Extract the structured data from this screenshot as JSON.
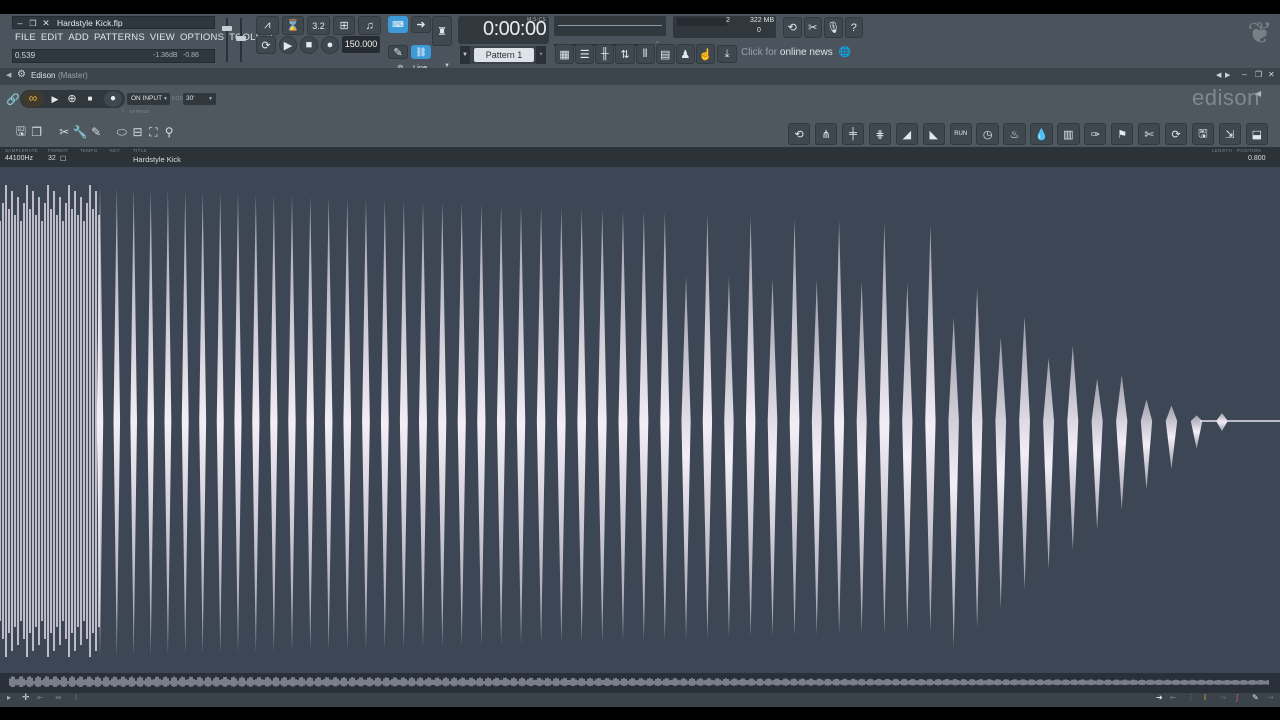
{
  "app": {
    "project_title": "Hardstyle Kick.flp",
    "menu": [
      "FILE",
      "EDIT",
      "ADD",
      "PATTERNS",
      "VIEW",
      "OPTIONS",
      "TOOLS",
      "?"
    ],
    "hint_value": "0.539",
    "hint_db": "-1.36dB",
    "hint_db2": "-0.86"
  },
  "transport": {
    "tempo": "150.000",
    "time": "0:00:00",
    "time_label": "M:S:CS",
    "pattern": "Pattern 1",
    "snap": "Line",
    "cpu_label": "2",
    "ram_label": "322 MB",
    "poly": "0",
    "news_prefix": "Click for ",
    "news_main": "online news"
  },
  "edison": {
    "title": "Edison",
    "subtitle": "(Master)",
    "logo": "edison",
    "input_label": "ON INPUT",
    "for_label": "FOR",
    "duration": "30'",
    "append_label": "APPEND"
  },
  "info": {
    "samplerate_label": "SAMPLERATE",
    "format_label": "FORMAT",
    "tempo_label": "TEMPO",
    "key_label": "KEY",
    "title_label": "TITLE",
    "length_label": "LENGTH",
    "position_label": "POSITION",
    "samplerate": "44100Hz",
    "bits": "32",
    "sample_title": "Hardstyle Kick",
    "position": "0.800"
  },
  "colors": {
    "accent": "#f2b23c",
    "waveform": "#e9e2ee",
    "wave_bg": "#3c4654"
  },
  "icons": [
    "link-icon",
    "loop-icon",
    "play-icon",
    "stop-icon",
    "record-icon",
    "save-icon",
    "copy-icon",
    "cut-icon",
    "wrench-icon",
    "pencil-icon",
    "globe-icon",
    "mic-icon",
    "help-icon"
  ]
}
